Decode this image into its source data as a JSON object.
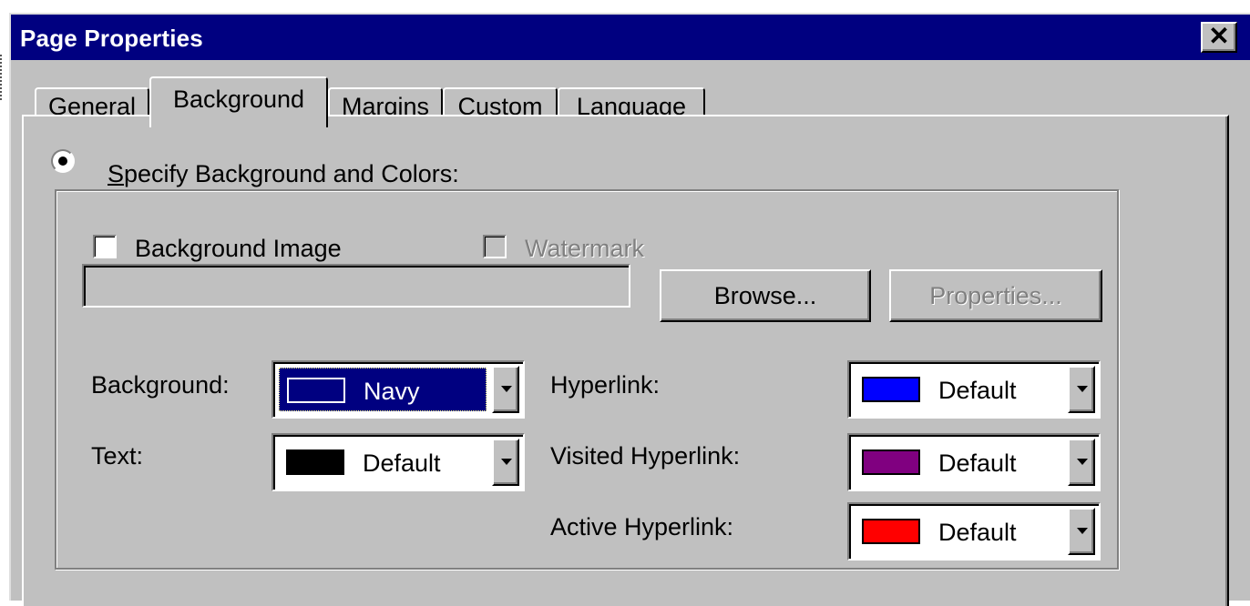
{
  "window": {
    "title": "Page Properties",
    "close_glyph": "✕"
  },
  "tabs": [
    {
      "label": "General",
      "active": false
    },
    {
      "label": "Background",
      "active": true
    },
    {
      "label": "Margins",
      "active": false
    },
    {
      "label": "Custom",
      "active": false
    },
    {
      "label": "Language",
      "active": false
    }
  ],
  "background_tab": {
    "specify_radio": {
      "label": "Specify Background and Colors:",
      "mnemonic": "S",
      "checked": true
    },
    "background_image": {
      "label": "Background Image",
      "checked": false
    },
    "watermark": {
      "label": "Watermark",
      "checked": false,
      "enabled": false
    },
    "image_path": "",
    "browse_button": "Browse...",
    "properties_button": "Properties...",
    "colors": {
      "background": {
        "label": "Background:",
        "value": "Navy",
        "swatch": "#000080",
        "selected": true
      },
      "text": {
        "label": "Text:",
        "value": "Default",
        "swatch": "#000000"
      },
      "hyperlink": {
        "label": "Hyperlink:",
        "value": "Default",
        "swatch": "#0000ff"
      },
      "visited_hyperlink": {
        "label": "Visited Hyperlink:",
        "value": "Default",
        "swatch": "#800080"
      },
      "active_hyperlink": {
        "label": "Active Hyperlink:",
        "value": "Default",
        "swatch": "#ff0000"
      }
    }
  },
  "theme": {
    "face": "#c0c0c0",
    "titlebar": "#000080"
  }
}
